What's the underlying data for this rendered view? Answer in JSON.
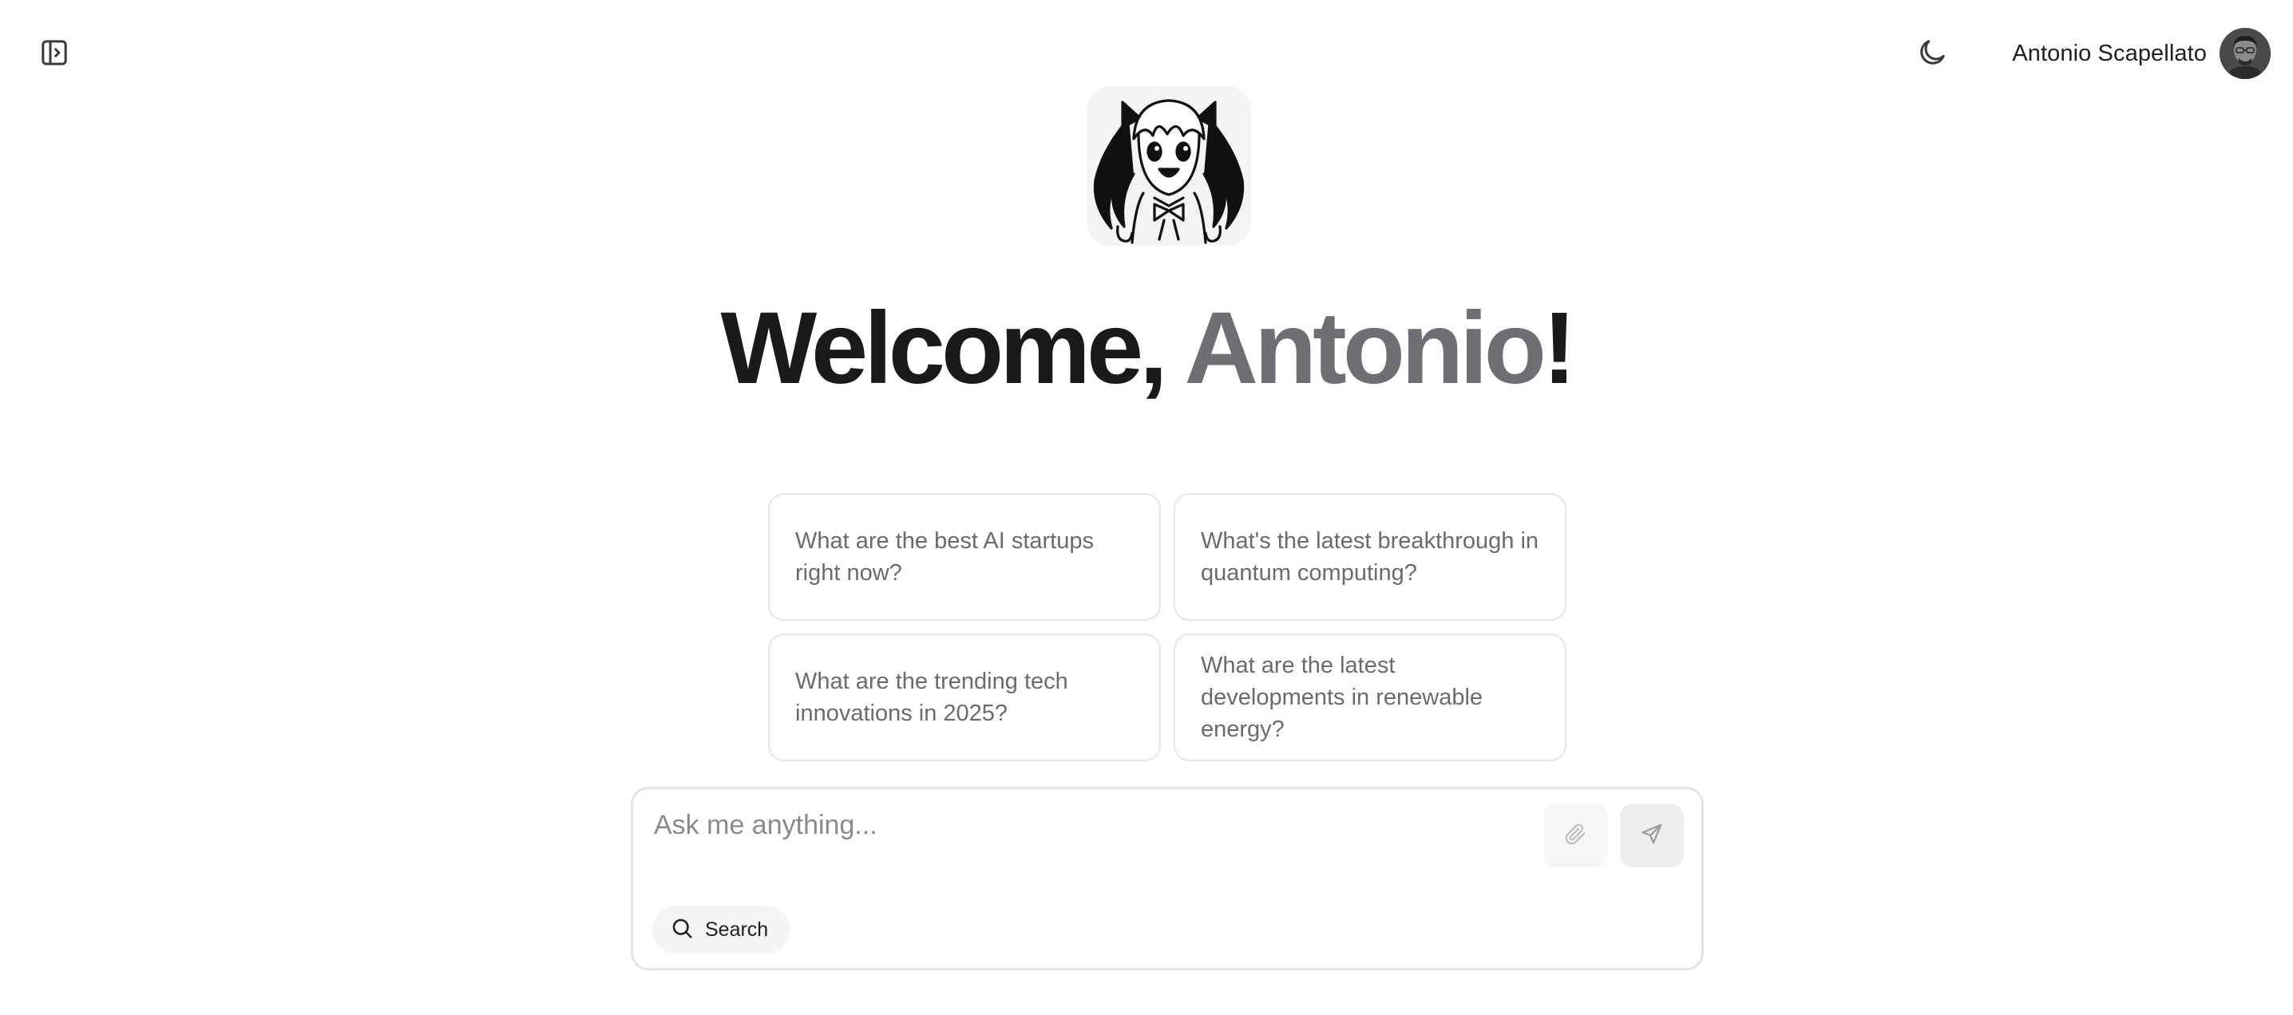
{
  "header": {
    "sidebar_toggle_icon": "sidebar-toggle-icon",
    "theme_toggle_icon": "moon-icon",
    "user": {
      "name": "Antonio Scapellato",
      "avatar_icon": "user-avatar"
    }
  },
  "hero": {
    "mascot_icon": "anime-girl-mascot",
    "greeting": "Welcome,",
    "name": "Antonio",
    "exclamation": "!"
  },
  "suggestions": [
    "What are the best AI startups right now?",
    "What's the latest breakthrough in quantum computing?",
    "What are the trending tech innovations in 2025?",
    "What are the latest developments in renewable energy?"
  ],
  "composer": {
    "placeholder": "Ask me anything...",
    "value": "",
    "attach_icon": "paperclip-icon",
    "send_icon": "send-icon",
    "search_icon": "search-icon",
    "search_label": "Search"
  },
  "colors": {
    "text_primary": "#1a1a1a",
    "text_muted": "#6e6e73",
    "card_border": "#e6e6e6",
    "button_bg": "#eeeeee"
  }
}
